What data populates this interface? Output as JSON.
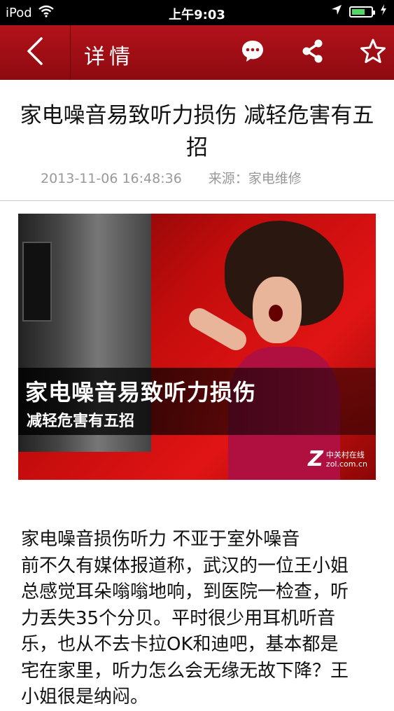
{
  "status_bar": {
    "device": "iPod",
    "time": "上午9:03"
  },
  "nav": {
    "title": "详情"
  },
  "article": {
    "title": "家电噪音易致听力损伤 减轻危害有五招",
    "timestamp": "2013-11-06 16:48:36",
    "source": "来源：家电维修",
    "image": {
      "caption_line1": "家电噪音易致听力损伤",
      "caption_line2": "减轻危害有五招",
      "logo_mark": "Z",
      "logo_name": "中关村在线",
      "logo_domain": "zol.com.cn"
    },
    "body": [
      "家电噪音损伤听力 不亚于室外噪音",
      "前不久有媒体报道称，武汉的一位王小姐总感觉耳朵嗡嗡地响，到医院一检查，听力丢失35个分贝。平时很少用耳机听音乐，也从不去卡拉OK和迪吧，基本都是宅在家里，听力怎么会无缘无故下降？王小姐很是纳闷。"
    ]
  },
  "battery_level": 0.7,
  "colors": {
    "nav_red": "#a3111a",
    "status_black": "#000000",
    "meta_gray": "#999999",
    "battery_green": "#4cd964"
  },
  "icons": [
    "wifi-icon",
    "location-arrow-icon",
    "battery-icon",
    "charging-icon",
    "back-chevron-icon",
    "comment-icon",
    "share-icon",
    "star-icon"
  ]
}
